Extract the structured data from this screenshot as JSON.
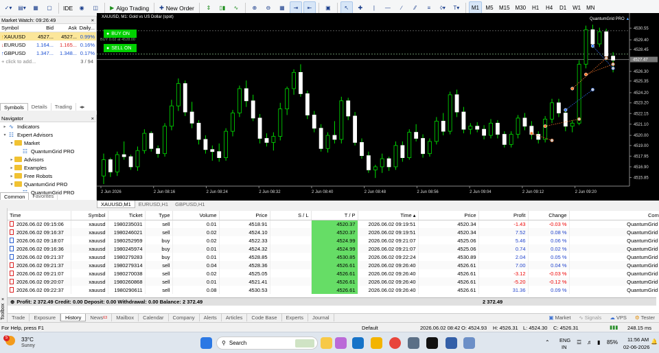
{
  "toolbar": {
    "algo_trading": "Algo Trading",
    "new_order": "New Order",
    "ide": "IDE",
    "timeframes": [
      "M1",
      "M5",
      "M15",
      "M30",
      "H1",
      "H4",
      "D1",
      "W1",
      "MN"
    ],
    "active_tf": "M1"
  },
  "market_watch": {
    "title": "Market Watch: 09:26:49",
    "headers": [
      "Symbol",
      "Bid",
      "Ask",
      "Daily..."
    ],
    "rows": [
      {
        "symbol": "XAUUSD",
        "bid": "4527...",
        "ask": "4527...",
        "daily": "0.99%"
      },
      {
        "symbol": "EURUSD",
        "bid": "1.164...",
        "ask": "1.165...",
        "daily": "0.16%"
      },
      {
        "symbol": "GBPUSD",
        "bid": "1.347...",
        "ask": "1.348...",
        "daily": "0.17%"
      }
    ],
    "add_text": "click to add...",
    "count": "3 / 94",
    "tabs": [
      "Symbols",
      "Details",
      "Trading"
    ]
  },
  "navigator": {
    "title": "Navigator",
    "items": [
      {
        "label": "Indicators",
        "level": 1
      },
      {
        "label": "Expert Advisors",
        "level": 1
      },
      {
        "label": "Market",
        "level": 2
      },
      {
        "label": "QuantumGrid PRO",
        "level": 3
      },
      {
        "label": "Advisors",
        "level": 2
      },
      {
        "label": "Examples",
        "level": 2
      },
      {
        "label": "Free Robots",
        "level": 2
      },
      {
        "label": "QuantumGrid PRO",
        "level": 2
      },
      {
        "label": "QuantumGrid PRO",
        "level": 3
      }
    ],
    "tabs": [
      "Common",
      "Favorites"
    ]
  },
  "chart": {
    "symbol_line": "XAUUSD, M1:  Gold vs US Dollar (spot)",
    "ea_name": "QuantumGrid PRO",
    "buy_label": "BUY ON",
    "sell_label": "SELL ON",
    "buy_line_label": "BUY 0.02 at 4528.00",
    "current_price": "4527.47",
    "price_labels": [
      "4530.55",
      "4529.40",
      "4528.45",
      "4527.47",
      "4526.30",
      "4525.35",
      "4524.20",
      "4523.20",
      "4522.15",
      "4521.10",
      "4520.00",
      "4519.00",
      "4517.95",
      "4516.90",
      "4515.85"
    ],
    "time_labels": [
      "2 Jun 2026",
      "2 Jun 08:16",
      "2 Jun 08:24",
      "2 Jun 08:32",
      "2 Jun 08:40",
      "2 Jun 08:48",
      "2 Jun 08:56",
      "2 Jun 09:04",
      "2 Jun 09:12",
      "2 Jun 09:20"
    ],
    "tabs": [
      "XAUUSD,M1",
      "EURUSD,H1",
      "GBPUSD,H1"
    ]
  },
  "chart_data": {
    "type": "candlestick",
    "ylim": [
      4515.0,
      4531.5
    ],
    "candles": [
      [
        4516.0,
        4518.2,
        4515.2,
        4517.6
      ],
      [
        4517.6,
        4517.8,
        4515.9,
        4516.4
      ],
      [
        4516.4,
        4518.4,
        4516.0,
        4518.1
      ],
      [
        4518.1,
        4519.4,
        4517.6,
        4517.9
      ],
      [
        4517.9,
        4518.1,
        4516.6,
        4516.9
      ],
      [
        4516.9,
        4518.9,
        4516.5,
        4518.5
      ],
      [
        4518.5,
        4520.6,
        4518.2,
        4520.2
      ],
      [
        4520.2,
        4520.4,
        4518.4,
        4518.7
      ],
      [
        4518.7,
        4519.0,
        4517.8,
        4518.2
      ],
      [
        4518.2,
        4521.2,
        4517.9,
        4520.9
      ],
      [
        4520.9,
        4523.5,
        4520.5,
        4522.9
      ],
      [
        4522.9,
        4525.6,
        4522.4,
        4525.1
      ],
      [
        4525.1,
        4525.4,
        4521.9,
        4522.3
      ],
      [
        4522.3,
        4523.3,
        4520.7,
        4521.2
      ],
      [
        4521.2,
        4521.5,
        4519.1,
        4519.6
      ],
      [
        4519.6,
        4520.0,
        4518.2,
        4518.6
      ],
      [
        4518.6,
        4519.0,
        4517.5,
        4518.4
      ],
      [
        4518.4,
        4519.2,
        4517.4,
        4517.8
      ],
      [
        4517.8,
        4520.7,
        4517.5,
        4520.4
      ],
      [
        4520.4,
        4522.5,
        4519.9,
        4522.2
      ],
      [
        4522.2,
        4524.9,
        4521.8,
        4524.6
      ],
      [
        4524.6,
        4525.4,
        4522.8,
        4523.4
      ],
      [
        4523.4,
        4524.0,
        4521.4,
        4521.7
      ],
      [
        4521.7,
        4522.1,
        4519.2,
        4519.7
      ],
      [
        4519.7,
        4520.2,
        4518.9,
        4519.3
      ],
      [
        4519.3,
        4520.3,
        4518.5,
        4519.9
      ],
      [
        4519.9,
        4523.2,
        4519.5,
        4522.6
      ],
      [
        4522.6,
        4524.8,
        4522.0,
        4524.6
      ],
      [
        4524.6,
        4526.5,
        4524.0,
        4526.2
      ],
      [
        4526.2,
        4527.0,
        4523.8,
        4524.1
      ],
      [
        4524.1,
        4524.4,
        4521.6,
        4522.0
      ],
      [
        4522.0,
        4522.4,
        4520.3,
        4520.7
      ],
      [
        4520.7,
        4521.1,
        4518.4,
        4518.7
      ],
      [
        4518.7,
        4520.3,
        4518.3,
        4520.0
      ],
      [
        4520.0,
        4521.4,
        4519.2,
        4519.6
      ],
      [
        4519.6,
        4523.8,
        4519.2,
        4523.4
      ],
      [
        4523.4,
        4523.7,
        4521.5,
        4521.9
      ],
      [
        4521.9,
        4522.3,
        4519.0,
        4519.3
      ],
      [
        4519.3,
        4519.7,
        4517.7,
        4518.0
      ],
      [
        4518.0,
        4518.4,
        4516.3,
        4516.6
      ],
      [
        4516.6,
        4517.1,
        4515.8,
        4516.9
      ],
      [
        4516.9,
        4518.2,
        4516.3,
        4517.7
      ],
      [
        4517.7,
        4517.9,
        4516.5,
        4516.9
      ],
      [
        4516.9,
        4519.4,
        4516.6,
        4519.0
      ],
      [
        4519.0,
        4519.4,
        4517.4,
        4517.8
      ],
      [
        4517.8,
        4520.6,
        4517.6,
        4520.3
      ],
      [
        4520.3,
        4521.1,
        4519.4,
        4519.7
      ],
      [
        4519.7,
        4520.1,
        4517.8,
        4518.2
      ],
      [
        4518.2,
        4519.7,
        4517.9,
        4519.4
      ],
      [
        4519.4,
        4521.8,
        4519.1,
        4521.4
      ],
      [
        4521.4,
        4522.2,
        4520.0,
        4520.4
      ],
      [
        4520.4,
        4524.3,
        4520.1,
        4524.0
      ],
      [
        4524.0,
        4524.5,
        4521.8,
        4522.3
      ],
      [
        4522.3,
        4522.8,
        4520.2,
        4520.6
      ],
      [
        4520.6,
        4521.2,
        4520.1,
        4520.9
      ],
      [
        4520.9,
        4521.3,
        4520.3,
        4520.6
      ],
      [
        4520.6,
        4521.0,
        4519.6,
        4520.0
      ],
      [
        4520.0,
        4521.6,
        4519.7,
        4521.2
      ],
      [
        4521.2,
        4521.5,
        4519.7,
        4520.1
      ],
      [
        4520.1,
        4520.4,
        4518.8,
        4519.1
      ],
      [
        4519.1,
        4520.4,
        4518.8,
        4520.1
      ],
      [
        4520.1,
        4522.0,
        4519.7,
        4521.7
      ],
      [
        4521.7,
        4522.2,
        4520.5,
        4520.9
      ],
      [
        4520.9,
        4521.4,
        4519.6,
        4520.1
      ],
      [
        4520.1,
        4520.4,
        4519.2,
        4519.6
      ],
      [
        4519.6,
        4521.9,
        4519.3,
        4521.6
      ],
      [
        4521.6,
        4523.6,
        4521.2,
        4523.2
      ],
      [
        4523.2,
        4523.6,
        4521.8,
        4522.2
      ],
      [
        4522.2,
        4522.6,
        4520.4,
        4520.9
      ],
      [
        4520.9,
        4521.5,
        4520.3,
        4521.2
      ],
      [
        4521.2,
        4527.4,
        4521.0,
        4527.0
      ],
      [
        4527.0,
        4530.8,
        4526.6,
        4530.4
      ],
      [
        4530.4,
        4530.9,
        4528.6,
        4529.0
      ],
      [
        4529.0,
        4530.6,
        4528.7,
        4530.2
      ],
      [
        4530.2,
        4530.5,
        4527.4,
        4527.8
      ],
      [
        4527.8,
        4528.2,
        4526.2,
        4527.4
      ]
    ],
    "title": "XAUUSD, M1"
  },
  "trade": {
    "headers": [
      "Time",
      "Symbol",
      "Ticket",
      "Type",
      "Volume",
      "Price",
      "S / L",
      "T / P",
      "Time",
      "Price",
      "Profit",
      "Change",
      "Comment"
    ],
    "rows": [
      [
        "2026.06.02 09:15:06",
        "xauusd",
        "1980235031",
        "sell",
        "0.01",
        "4518.91",
        "",
        "4520.37",
        "2026.06.02 09:19:51",
        "4520.34",
        "-1.43",
        "-0.03 %",
        "QuantumGrid PRO"
      ],
      [
        "2026.06.02 09:16:37",
        "xauusd",
        "1980246021",
        "sell",
        "0.02",
        "4524.10",
        "",
        "4520.37",
        "2026.06.02 09:19:51",
        "4520.34",
        "7.52",
        "0.08 %",
        "QuantumGrid PRO"
      ],
      [
        "2026.06.02 09:18:07",
        "xauusd",
        "1980252959",
        "buy",
        "0.02",
        "4522.33",
        "",
        "4524.99",
        "2026.06.02 09:21:07",
        "4525.06",
        "5.46",
        "0.06 %",
        "QuantumGrid PRO"
      ],
      [
        "2026.06.02 09:16:36",
        "xauusd",
        "1980245974",
        "buy",
        "0.01",
        "4524.32",
        "",
        "4524.99",
        "2026.06.02 09:21:07",
        "4525.06",
        "0.74",
        "0.02 %",
        "QuantumGrid PRO"
      ],
      [
        "2026.06.02 09:21:37",
        "xauusd",
        "1980279283",
        "buy",
        "0.01",
        "4528.85",
        "",
        "4530.85",
        "2026.06.02 09:22:24",
        "4530.89",
        "2.04",
        "0.05 %",
        "QuantumGrid PRO"
      ],
      [
        "2026.06.02 09:21:37",
        "xauusd",
        "1980279314",
        "sell",
        "0.04",
        "4528.36",
        "",
        "4526.61",
        "2026.06.02 09:26:40",
        "4526.61",
        "7.00",
        "0.04 %",
        "QuantumGrid PRO"
      ],
      [
        "2026.06.02 09:21:07",
        "xauusd",
        "1980270038",
        "sell",
        "0.02",
        "4525.05",
        "",
        "4526.61",
        "2026.06.02 09:26:40",
        "4526.61",
        "-3.12",
        "-0.03 %",
        "QuantumGrid PRO"
      ],
      [
        "2026.06.02 09:20:07",
        "xauusd",
        "1980260868",
        "sell",
        "0.01",
        "4521.41",
        "",
        "4526.61",
        "2026.06.02 09:26:40",
        "4526.61",
        "-5.20",
        "-0.12 %",
        "QuantumGrid PRO"
      ],
      [
        "2026.06.02 09:22:37",
        "xauusd",
        "1980290611",
        "sell",
        "0.08",
        "4530.53",
        "",
        "4526.61",
        "2026.06.02 09:26:40",
        "4526.61",
        "31.36",
        "0.09 %",
        "QuantumGrid PRO"
      ]
    ],
    "summary": "Profit: 2 372.49  Credit: 0.00  Deposit: 0.00  Withdrawal: 0.00  Balance: 2 372.49",
    "summary_total": "2 372.49",
    "tabs": [
      "Trade",
      "Exposure",
      "History",
      "News",
      "Mailbox",
      "Calendar",
      "Company",
      "Alerts",
      "Articles",
      "Code Base",
      "Experts",
      "Journal"
    ],
    "news_badge": "63",
    "right_tabs": [
      "Market",
      "Signals",
      "VPS",
      "Tester"
    ]
  },
  "status": {
    "help": "For Help, press F1",
    "profile": "Default",
    "datetime": "2026.06.02 08:42",
    "o": "O: 4524.93",
    "h": "H: 4526.31",
    "l": "L: 4524.30",
    "c": "C: 4526.31",
    "traffic": "248.15 ms",
    "toolbox": "Toolbox"
  },
  "taskbar": {
    "temp": "33°C",
    "weather": "Sunny",
    "badge": "5",
    "search": "Search",
    "lang1": "ENG",
    "lang2": "IN",
    "battery": "85%",
    "time": "11:56 AM",
    "date": "02-06-2026"
  }
}
